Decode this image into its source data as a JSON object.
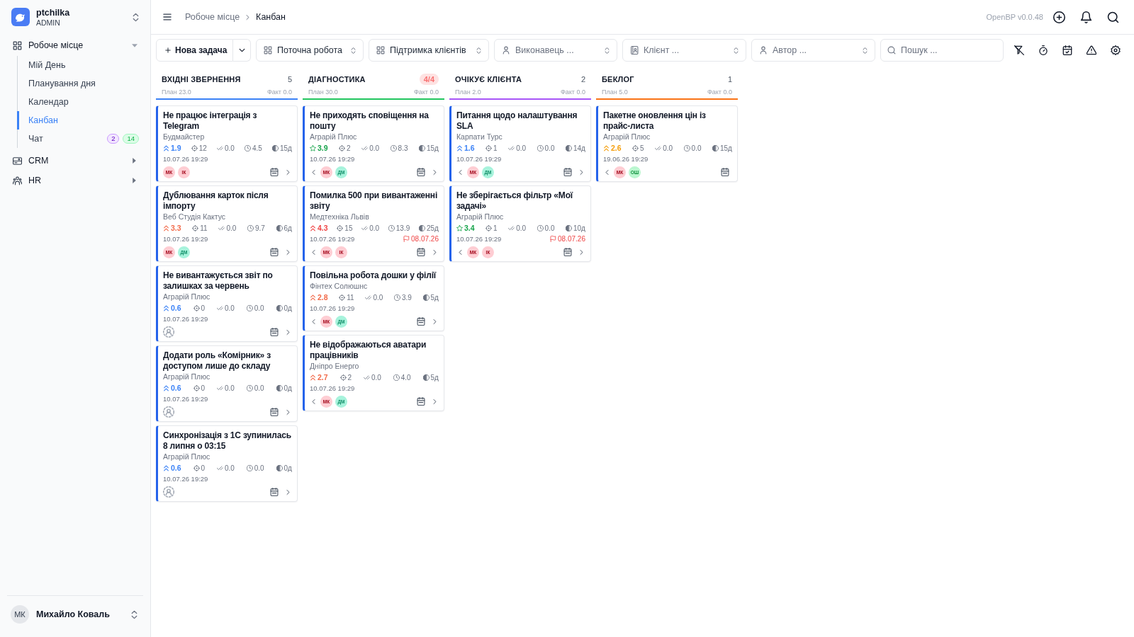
{
  "sidebar": {
    "workspace": {
      "name": "ptchilka",
      "role": "ADMIN"
    },
    "nav": [
      {
        "label": "Робоче місце",
        "expanded": true,
        "children": [
          {
            "label": "Мій День",
            "selected": false
          },
          {
            "label": "Планування дня",
            "selected": false
          },
          {
            "label": "Календар",
            "selected": false
          },
          {
            "label": "Канбан",
            "selected": true
          },
          {
            "label": "Чат",
            "selected": false,
            "badges": [
              {
                "text": "2",
                "color": "#f3e8ff"
              },
              {
                "text": "14",
                "color": "#dcfce7"
              }
            ]
          }
        ]
      },
      {
        "label": "CRM",
        "expanded": false
      },
      {
        "label": "HR",
        "expanded": false
      }
    ],
    "user": {
      "initials": "МК",
      "name": "Михайло Коваль"
    }
  },
  "header": {
    "breadcrumbs": [
      "Робоче місце",
      "Канбан"
    ],
    "version": "OpenBP v0.0.48"
  },
  "toolbar": {
    "new_button": "Нова задача",
    "filters": [
      {
        "value": "Поточна робота"
      },
      {
        "value": "Підтримка клієнтів"
      },
      {
        "placeholder": "Виконавець ..."
      },
      {
        "placeholder": "Клієнт ..."
      },
      {
        "placeholder": "Автор ..."
      }
    ],
    "search": {
      "placeholder": "Пошук ..."
    }
  },
  "columns": [
    {
      "title": "ВХІДНІ ЗВЕРНЕННЯ",
      "count": "5",
      "over_limit": false,
      "plan": "План 23.0",
      "fact": "Факт 0.0",
      "color": "#3b82f6",
      "cards": [
        {
          "title": "Не працює інтеграція з Telegram",
          "client": "Будмайстер",
          "priority": {
            "kind": "chevrons",
            "color": "#3b82f6",
            "value": "1.9"
          },
          "metrics": [
            "12",
            "0.0",
            "4.5",
            "15д"
          ],
          "created": "10.07.26 19:29",
          "assignees": [
            {
              "initials": "МК",
              "color": "#fecdd3"
            },
            {
              "initials": "ІК",
              "color": "#fecdd3"
            }
          ],
          "has_prev": false,
          "has_next": true
        },
        {
          "title": "Дублювання карток після імпорту",
          "client": "Веб Студія Кактус",
          "priority": {
            "kind": "chevrons",
            "color": "#f26b4b",
            "value": "3.3"
          },
          "metrics": [
            "11",
            "0.0",
            "9.7",
            "6д"
          ],
          "created": "10.07.26 19:29",
          "assignees": [
            {
              "initials": "МК",
              "color": "#fecdd3"
            },
            {
              "initials": "ДМ",
              "color": "#a7f3dc"
            }
          ],
          "has_prev": false,
          "has_next": true
        },
        {
          "title": "Не вивантажується звіт по залишках за червень",
          "client": "Аграрій Плюс",
          "priority": {
            "kind": "chevrons",
            "color": "#3b82f6",
            "value": "0.6"
          },
          "metrics": [
            "0",
            "0.0",
            "0.0",
            "0д"
          ],
          "created": "10.07.26 19:29",
          "has_prev": false,
          "has_next": true
        },
        {
          "title": "Додати роль «Комірник» з доступом лише до складу",
          "client": "Аграрій Плюс",
          "priority": {
            "kind": "chevrons",
            "color": "#3b82f6",
            "value": "0.6"
          },
          "metrics": [
            "0",
            "0.0",
            "0.0",
            "0д"
          ],
          "created": "10.07.26 19:29",
          "has_prev": false,
          "has_next": true
        },
        {
          "title": "Синхронізація з 1С зупинилась 8 липня о 03:15",
          "client": "Аграрій Плюс",
          "priority": {
            "kind": "chevrons",
            "color": "#3b82f6",
            "value": "0.6"
          },
          "metrics": [
            "0",
            "0.0",
            "0.0",
            "0д"
          ],
          "created": "10.07.26 19:29",
          "has_prev": false,
          "has_next": true
        }
      ]
    },
    {
      "title": "ДІАГНОСТИКА",
      "count": "4/4",
      "over_limit": true,
      "plan": "План 30.0",
      "fact": "Факт 0.0",
      "color": "#22c55e",
      "cards": [
        {
          "title": "Не приходять сповіщення на пошту",
          "client": "Аграрій Плюс",
          "priority": {
            "kind": "star",
            "color": "#16a34a",
            "value": "3.9"
          },
          "metrics": [
            "2",
            "0.0",
            "8.3",
            "15д"
          ],
          "created": "10.07.26 19:29",
          "assignees": [
            {
              "initials": "МК",
              "color": "#fecdd3"
            },
            {
              "initials": "ДМ",
              "color": "#a7f3dc"
            }
          ],
          "has_prev": true,
          "has_next": true
        },
        {
          "title": "Помилка 500 при вивантаженні звіту",
          "client": "Медтехніка Львів",
          "priority": {
            "kind": "chevrons",
            "color": "#ef4444",
            "value": "4.3"
          },
          "metrics": [
            "15",
            "0.0",
            "13.9",
            "25д"
          ],
          "created": "10.07.26 19:29",
          "deadline": "08.07.26",
          "assignees": [
            {
              "initials": "МК",
              "color": "#fecdd3"
            },
            {
              "initials": "ІК",
              "color": "#fecdd3"
            }
          ],
          "has_prev": true,
          "has_next": true
        },
        {
          "title": "Повільна робота дошки у філії",
          "client": "Фінтех Солюшнс",
          "priority": {
            "kind": "chevrons",
            "color": "#f26b4b",
            "value": "2.8"
          },
          "metrics": [
            "11",
            "0.0",
            "3.9",
            "5д"
          ],
          "created": "10.07.26 19:29",
          "assignees": [
            {
              "initials": "МК",
              "color": "#fecdd3"
            },
            {
              "initials": "ДМ",
              "color": "#a7f3dc"
            }
          ],
          "has_prev": true,
          "has_next": true
        },
        {
          "title": "Не відображаються аватари працівників",
          "client": "Дніпро Енерго",
          "priority": {
            "kind": "chevrons",
            "color": "#f26b4b",
            "value": "2.7"
          },
          "metrics": [
            "2",
            "0.0",
            "4.0",
            "5д"
          ],
          "created": "10.07.26 19:29",
          "assignees": [
            {
              "initials": "МК",
              "color": "#fecdd3"
            },
            {
              "initials": "ДМ",
              "color": "#a7f3dc"
            }
          ],
          "has_prev": true,
          "has_next": true
        }
      ]
    },
    {
      "title": "ОЧІКУЄ КЛІЄНТА",
      "count": "2",
      "over_limit": false,
      "plan": "План 2.0",
      "fact": "Факт 0.0",
      "color": "#a855f7",
      "cards": [
        {
          "title": "Питання щодо налаштування SLA",
          "client": "Карпати Турс",
          "priority": {
            "kind": "chevrons",
            "color": "#3b82f6",
            "value": "1.6"
          },
          "metrics": [
            "1",
            "0.0",
            "0.0",
            "14д"
          ],
          "created": "10.07.26 19:29",
          "assignees": [
            {
              "initials": "МК",
              "color": "#fecdd3"
            },
            {
              "initials": "ДМ",
              "color": "#a7f3dc"
            }
          ],
          "has_prev": true,
          "has_next": true
        },
        {
          "title": "Не зберігається фільтр «Мої задачі»",
          "client": "Аграрій Плюс",
          "priority": {
            "kind": "star",
            "color": "#16a34a",
            "value": "3.4"
          },
          "metrics": [
            "1",
            "0.0",
            "0.0",
            "10д"
          ],
          "created": "10.07.26 19:29",
          "deadline": "08.07.26",
          "assignees": [
            {
              "initials": "МК",
              "color": "#fecdd3"
            },
            {
              "initials": "ІК",
              "color": "#fecdd3"
            }
          ],
          "has_prev": true,
          "has_next": true
        }
      ]
    },
    {
      "title": "БЕКЛОГ",
      "count": "1",
      "over_limit": false,
      "plan": "План 5.0",
      "fact": "Факт 0.0",
      "color": "#f97316",
      "cards": [
        {
          "title": "Пакетне оновлення цін із прайс-листа",
          "client": "Аграрій Плюс",
          "priority": {
            "kind": "chevrons",
            "color": "#f59e0b",
            "value": "2.6"
          },
          "metrics": [
            "5",
            "0.0",
            "0.0",
            "15д"
          ],
          "created": "19.06.26 19:29",
          "assignees": [
            {
              "initials": "МК",
              "color": "#fecdd3"
            },
            {
              "initials": "ОШ",
              "color": "#bbf7d0"
            }
          ],
          "has_prev": true,
          "has_next": false
        }
      ]
    }
  ]
}
